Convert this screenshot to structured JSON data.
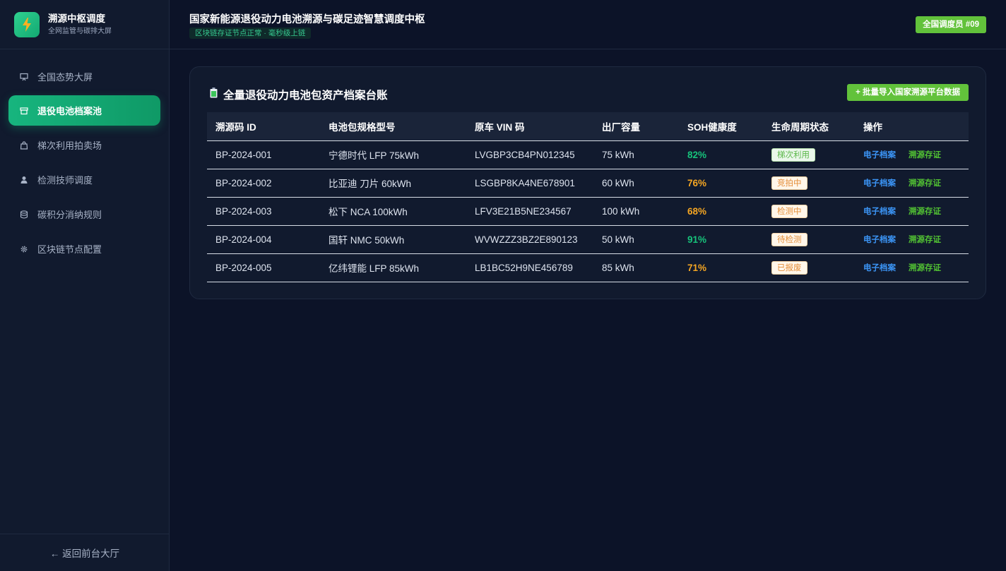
{
  "brand": {
    "title": "溯源中枢调度",
    "subtitle": "全网监管与碳排大屏",
    "logo_icon": "lightning-icon"
  },
  "nav": {
    "items": [
      {
        "label": "全国态势大屏",
        "icon": "monitor-icon",
        "active": false
      },
      {
        "label": "退役电池档案池",
        "icon": "archive-icon",
        "active": true
      },
      {
        "label": "梯次利用拍卖场",
        "icon": "shopping-bag-icon",
        "active": false
      },
      {
        "label": "检测技师调度",
        "icon": "user-icon",
        "active": false
      },
      {
        "label": "碳积分消纳规则",
        "icon": "database-icon",
        "active": false
      },
      {
        "label": "区块链节点配置",
        "icon": "gear-icon",
        "active": false
      }
    ],
    "back_label": "← 返回前台大厅"
  },
  "header": {
    "title": "国家新能源退役动力电池溯源与碳足迹智慧调度中枢",
    "status": "区块链存证节点正常 · 毫秒级上链",
    "user_badge": "全国调度员 #09"
  },
  "card": {
    "title": "全量退役动力电池包资产档案台账",
    "title_icon": "battery-icon",
    "import_button": "+ 批量导入国家溯源平台数据"
  },
  "table": {
    "columns": [
      "溯源码 ID",
      "电池包规格型号",
      "原车 VIN 码",
      "出厂容量",
      "SOH健康度",
      "生命周期状态",
      "操作"
    ],
    "rows": [
      {
        "id": "BP-2024-001",
        "model": "宁德时代 LFP 75kWh",
        "vin": "LVGBP3CB4PN012345",
        "capacity": "75 kWh",
        "soh": "82%",
        "soh_color": "#17c37b",
        "status": "梯次利用",
        "status_style": "green",
        "action1": "电子档案",
        "action2": "溯源存证"
      },
      {
        "id": "BP-2024-002",
        "model": "比亚迪 刀片 60kWh",
        "vin": "LSGBP8KA4NE678901",
        "capacity": "60 kWh",
        "soh": "76%",
        "soh_color": "#f5a623",
        "status": "竞拍中",
        "status_style": "orange",
        "action1": "电子档案",
        "action2": "溯源存证"
      },
      {
        "id": "BP-2024-003",
        "model": "松下 NCA 100kWh",
        "vin": "LFV3E21B5NE234567",
        "capacity": "100 kWh",
        "soh": "68%",
        "soh_color": "#f5a623",
        "status": "检测中",
        "status_style": "orange",
        "action1": "电子档案",
        "action2": "溯源存证"
      },
      {
        "id": "BP-2024-004",
        "model": "国轩 NMC 50kWh",
        "vin": "WVWZZZ3BZ2E890123",
        "capacity": "50 kWh",
        "soh": "91%",
        "soh_color": "#17c37b",
        "status": "待检测",
        "status_style": "orange",
        "action1": "电子档案",
        "action2": "溯源存证"
      },
      {
        "id": "BP-2024-005",
        "model": "亿纬锂能 LFP 85kWh",
        "vin": "LB1BC52H9NE456789",
        "capacity": "85 kWh",
        "soh": "71%",
        "soh_color": "#f5a623",
        "status": "已报废",
        "status_style": "orange",
        "action1": "电子档案",
        "action2": "溯源存证"
      }
    ]
  },
  "colors": {
    "accent_green": "#17b57e",
    "badge_green": "#62c23b",
    "link_blue": "#3b94f5",
    "warn_orange": "#f5a623"
  }
}
